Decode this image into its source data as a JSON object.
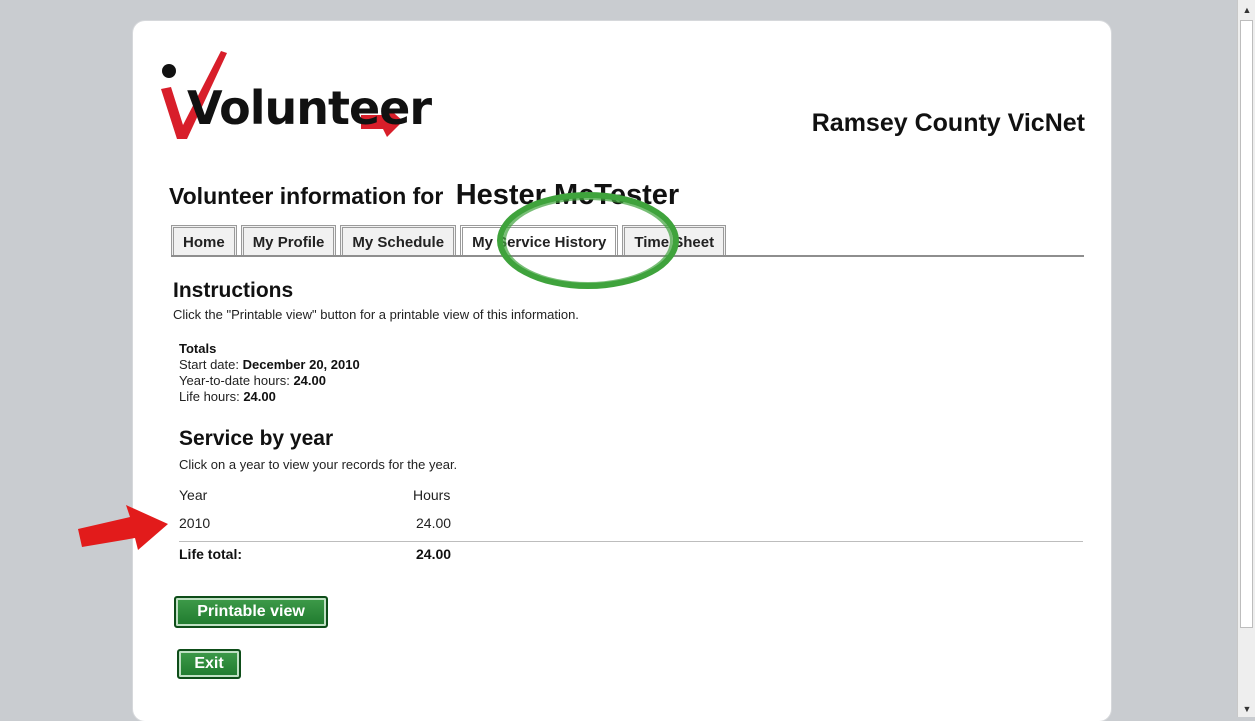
{
  "logo": {
    "text": "Volunteer"
  },
  "header": {
    "org_name": "Ramsey County VicNet",
    "heading_prefix": "Volunteer information for",
    "volunteer_name": "Hester McTester"
  },
  "tabs": [
    {
      "label": "Home"
    },
    {
      "label": "My Profile"
    },
    {
      "label": "My Schedule"
    },
    {
      "label": "My Service History",
      "active": true
    },
    {
      "label": "Time Sheet"
    }
  ],
  "instructions": {
    "heading": "Instructions",
    "text": "Click the \"Printable view\" button for a printable view of this information."
  },
  "totals": {
    "heading": "Totals",
    "start_label": "Start date:",
    "start_value": "December 20, 2010",
    "ytd_label": "Year-to-date hours:",
    "ytd_value": "24.00",
    "life_label": "Life hours:",
    "life_value": "24.00"
  },
  "service_by_year": {
    "heading": "Service by year",
    "text": "Click on a year to view your records for the year.",
    "columns": [
      "Year",
      "Hours"
    ],
    "rows": [
      {
        "year": "2010",
        "hours": "24.00"
      }
    ],
    "total_label": "Life total:",
    "total_value": "24.00"
  },
  "buttons": {
    "printable": "Printable view",
    "exit": "Exit"
  },
  "colors": {
    "highlight_circle": "#3fa33c",
    "arrow": "#e21b1b",
    "button_green": "#2a8a3a"
  }
}
